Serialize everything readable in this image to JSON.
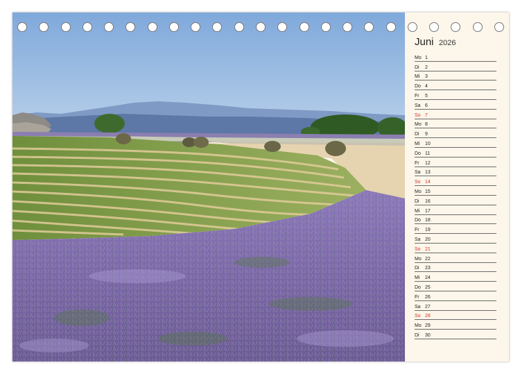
{
  "calendar": {
    "month": "Juni",
    "year": "2026",
    "days": [
      {
        "wd": "Mo",
        "d": "1",
        "sunday": false
      },
      {
        "wd": "Di",
        "d": "2",
        "sunday": false
      },
      {
        "wd": "Mi",
        "d": "3",
        "sunday": false
      },
      {
        "wd": "Do",
        "d": "4",
        "sunday": false
      },
      {
        "wd": "Fr",
        "d": "5",
        "sunday": false
      },
      {
        "wd": "Sa",
        "d": "6",
        "sunday": false
      },
      {
        "wd": "So",
        "d": "7",
        "sunday": true
      },
      {
        "wd": "Mo",
        "d": "8",
        "sunday": false
      },
      {
        "wd": "Di",
        "d": "9",
        "sunday": false
      },
      {
        "wd": "Mi",
        "d": "10",
        "sunday": false
      },
      {
        "wd": "Do",
        "d": "11",
        "sunday": false
      },
      {
        "wd": "Fr",
        "d": "12",
        "sunday": false
      },
      {
        "wd": "Sa",
        "d": "13",
        "sunday": false
      },
      {
        "wd": "So",
        "d": "14",
        "sunday": true
      },
      {
        "wd": "Mo",
        "d": "15",
        "sunday": false
      },
      {
        "wd": "Di",
        "d": "16",
        "sunday": false
      },
      {
        "wd": "Mi",
        "d": "17",
        "sunday": false
      },
      {
        "wd": "Do",
        "d": "18",
        "sunday": false
      },
      {
        "wd": "Fr",
        "d": "19",
        "sunday": false
      },
      {
        "wd": "Sa",
        "d": "20",
        "sunday": false
      },
      {
        "wd": "So",
        "d": "21",
        "sunday": true
      },
      {
        "wd": "Mo",
        "d": "22",
        "sunday": false
      },
      {
        "wd": "Di",
        "d": "23",
        "sunday": false
      },
      {
        "wd": "Mi",
        "d": "24",
        "sunday": false
      },
      {
        "wd": "Do",
        "d": "25",
        "sunday": false
      },
      {
        "wd": "Fr",
        "d": "26",
        "sunday": false
      },
      {
        "wd": "Sa",
        "d": "27",
        "sunday": false
      },
      {
        "wd": "So",
        "d": "28",
        "sunday": true
      },
      {
        "wd": "Mo",
        "d": "29",
        "sunday": false
      },
      {
        "wd": "Di",
        "d": "30",
        "sunday": false
      }
    ]
  },
  "colors": {
    "sunday": "#d0342c",
    "paper": "#fdf6ea",
    "sky": "#8fb4e0",
    "lavender": "#7d6aa8",
    "green_rows": "#7d9a45"
  },
  "binding": {
    "ring_count": 23
  }
}
